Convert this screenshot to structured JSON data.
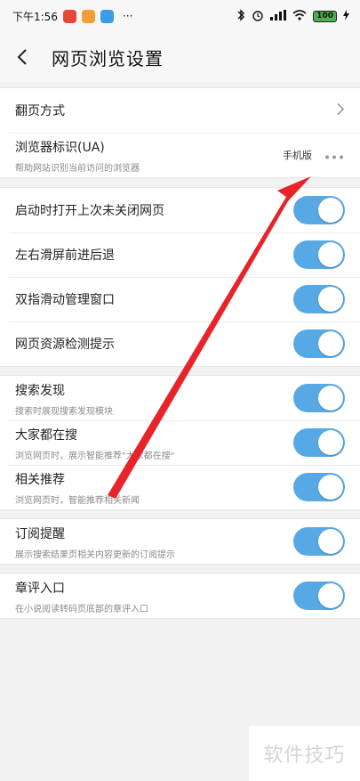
{
  "status_bar": {
    "time": "下午1:56",
    "more": "···",
    "battery": "100",
    "icons": [
      "bluetooth-icon",
      "alarm-icon",
      "signal-icon",
      "wifi-icon",
      "battery-icon",
      "charging-icon"
    ]
  },
  "header": {
    "title": "网页浏览设置",
    "back_icon": "back-chevron-icon"
  },
  "groups": {
    "g1": {
      "page_turn": {
        "title": "翻页方式"
      },
      "ua": {
        "title": "浏览器标识(UA)",
        "subtitle": "帮助网站识别当前访问的浏览器",
        "value": "手机版"
      }
    },
    "g2": {
      "items": [
        {
          "title": "启动时打开上次未关闭网页",
          "on": true
        },
        {
          "title": "左右滑屏前进后退",
          "on": true
        },
        {
          "title": "双指滑动管理窗口",
          "on": true
        },
        {
          "title": "网页资源检测提示",
          "on": true
        }
      ]
    },
    "g3": {
      "items": [
        {
          "title": "搜索发现",
          "subtitle": "搜索时展现搜索发现模块",
          "on": true
        },
        {
          "title": "大家都在搜",
          "subtitle": "浏览网页时，展示智能推荐\"大家都在搜\"",
          "on": true
        },
        {
          "title": "相关推荐",
          "subtitle": "浏览网页时，智能推荐相关新闻",
          "on": true
        }
      ]
    },
    "g4": {
      "items": [
        {
          "title": "订阅提醒",
          "subtitle": "展示搜索结果页相关内容更新的订阅提示",
          "on": true
        }
      ]
    },
    "g5": {
      "items": [
        {
          "title": "章评入口",
          "subtitle": "在小说阅读转码页底部的章评入口",
          "on": true
        }
      ]
    }
  },
  "annotation": {
    "arrow_color": "#e8232a"
  },
  "colors": {
    "toggle_on": "#57a9e5",
    "page_bg": "#f2f2f2"
  },
  "watermark": "软件技巧"
}
